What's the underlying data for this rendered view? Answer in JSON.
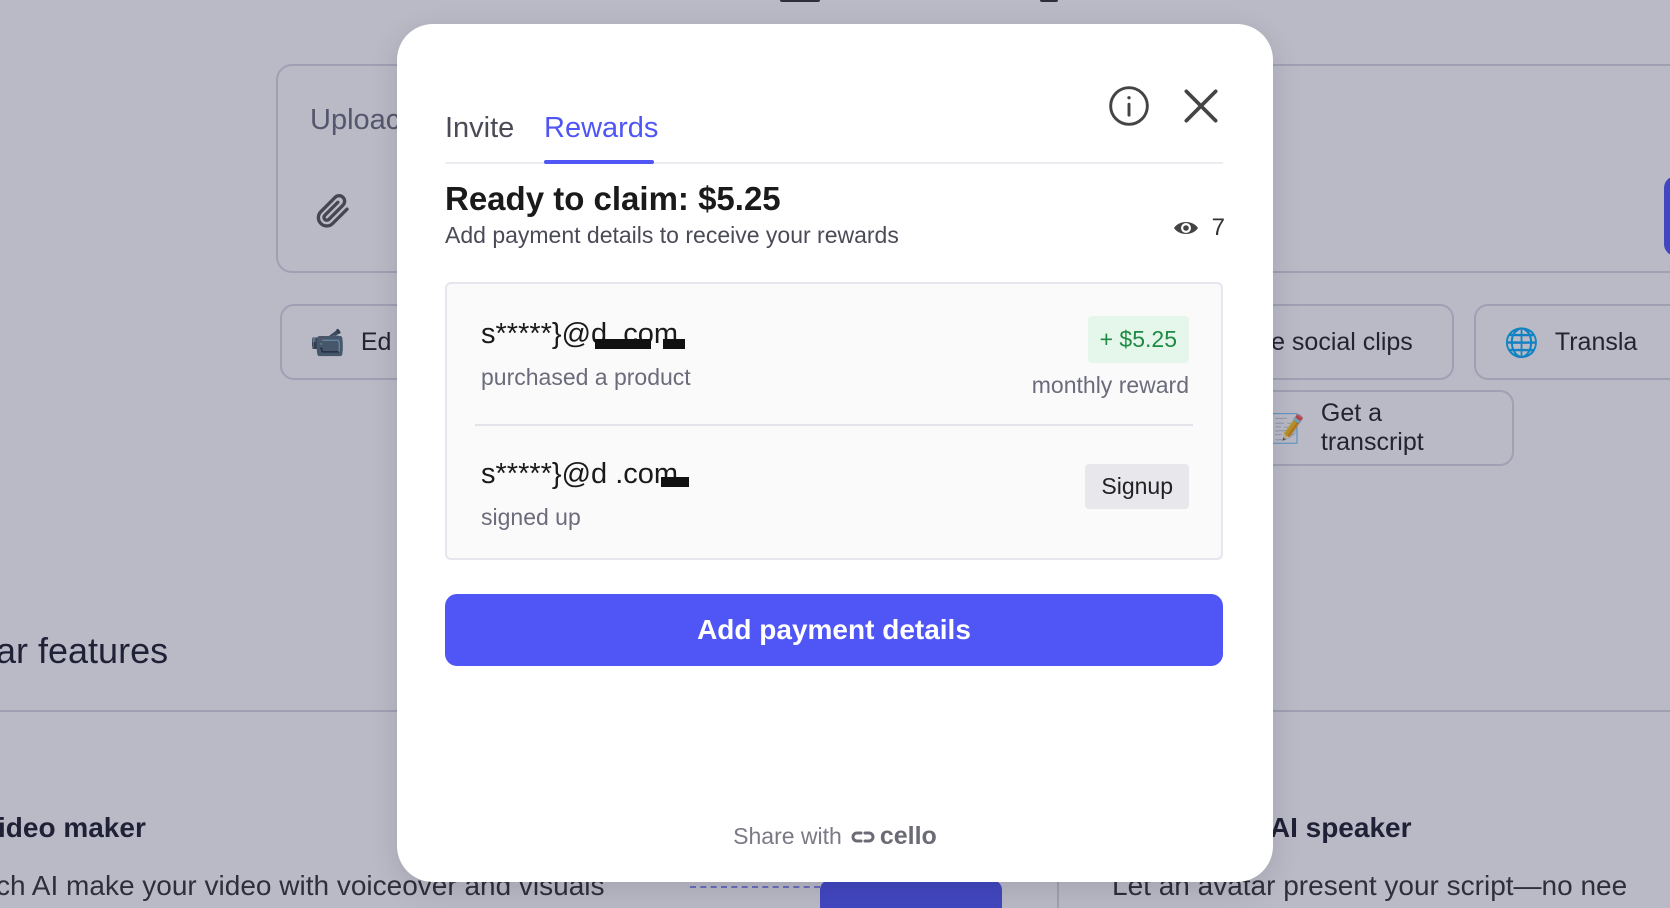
{
  "background": {
    "upload_placeholder": "Uploac",
    "chips": [
      {
        "emoji": "📹",
        "label": "Ed"
      },
      {
        "emoji": "",
        "label": "reate social clips"
      },
      {
        "emoji": "🌐",
        "label": "Transla"
      },
      {
        "emoji": "📝",
        "label": "Get a transcript"
      }
    ],
    "section_title": "ar features",
    "features": [
      {
        "title": "ideo maker",
        "desc": "ch AI make your video with voiceover and visuals"
      },
      {
        "title": "h AI speaker",
        "desc": "Let an avatar present your script—no nee"
      }
    ]
  },
  "modal": {
    "tabs": [
      {
        "label": "Invite",
        "active": false
      },
      {
        "label": "Rewards",
        "active": true
      }
    ],
    "info_icon": "info-icon",
    "close_icon": "close-icon",
    "claim_title": "Ready to claim: $5.25",
    "claim_subtitle": "Add payment details to receive your rewards",
    "views_count": "7",
    "rewards": [
      {
        "email": "s*****}@d        .com",
        "description": "purchased a product",
        "badge": "+ $5.25",
        "reward_type": "monthly reward"
      },
      {
        "email": "s*****}@d        .com",
        "description": "signed up",
        "badge": "Signup"
      }
    ],
    "primary_button": "Add payment details",
    "footer_text": "Share with",
    "footer_brand": "cello"
  },
  "colors": {
    "accent": "#4f56f5",
    "success": "#1f8a43",
    "success_bg": "#e5f7ea"
  }
}
